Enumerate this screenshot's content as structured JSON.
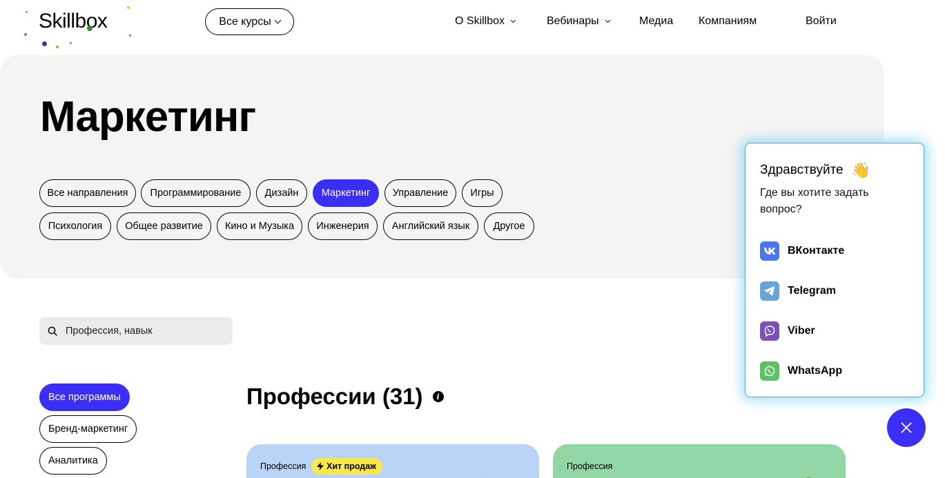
{
  "header": {
    "logo": "Skillbox",
    "courses_button": "Все курсы",
    "nav": [
      "О Skillbox",
      "Вебинары",
      "Медиа",
      "Компаниям"
    ],
    "login": "Войти"
  },
  "hero": {
    "title": "Маркетинг",
    "categories_row1": [
      "Все направления",
      "Программирование",
      "Дизайн",
      "Маркетинг",
      "Управление",
      "Игры"
    ],
    "categories_row2": [
      "Психология",
      "Общее развитие",
      "Кино и Музыка",
      "Инженерия",
      "Английский язык",
      "Другое"
    ],
    "active_category": "Маркетинг"
  },
  "search": {
    "placeholder": "Профессия, навык"
  },
  "filters": {
    "items": [
      "Все программы",
      "Бренд-маркетинг",
      "Аналитика"
    ],
    "active": "Все программы"
  },
  "professions": {
    "title": "Профессии (31)",
    "cards": [
      {
        "label": "Профессия",
        "badge": "Хит продаж",
        "color": "#b9d4f7"
      },
      {
        "label": "Профессия",
        "color": "#93d6a6"
      }
    ]
  },
  "chat": {
    "greeting": "Здравствуйте",
    "emoji": "👋",
    "question": "Где вы хотите задать вопрос?",
    "options": [
      {
        "label": "ВКонтакте",
        "icon": "vk-icon",
        "color": "#4a76f0"
      },
      {
        "label": "Telegram",
        "icon": "telegram-icon",
        "color": "#6aa3d8"
      },
      {
        "label": "Viber",
        "icon": "viber-icon",
        "color": "#7d50b8"
      },
      {
        "label": "WhatsApp",
        "icon": "whatsapp-icon",
        "color": "#5cc160"
      }
    ]
  },
  "colors": {
    "accent": "#3c2ff5",
    "hero_bg": "#f4f4f2",
    "badge": "#f7e94a"
  }
}
